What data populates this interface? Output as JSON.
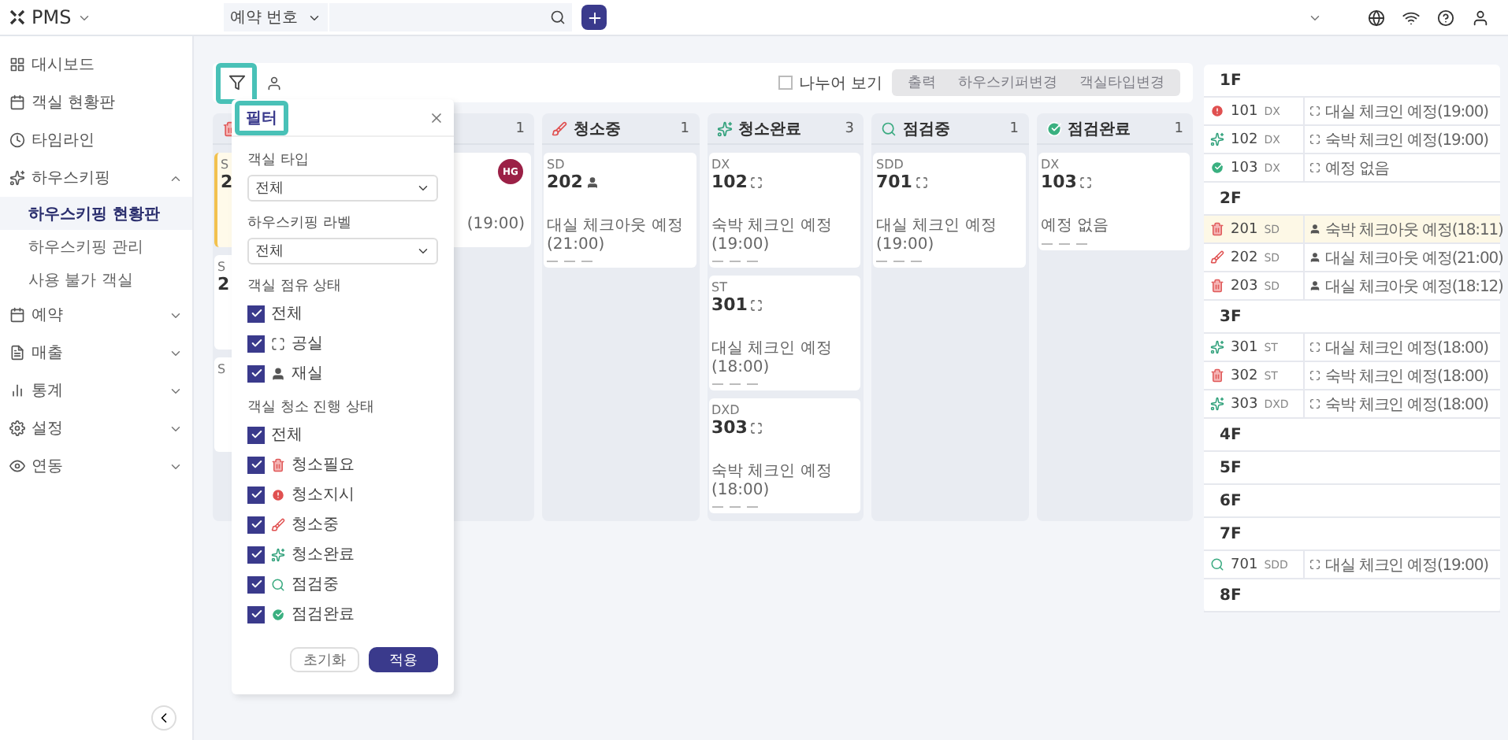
{
  "app": {
    "name": "PMS"
  },
  "search": {
    "field": "예약 번호"
  },
  "sidebar": {
    "items": [
      {
        "kind": "dashboard",
        "label": "대시보드"
      },
      {
        "kind": "rooms",
        "label": "객실 현황판"
      },
      {
        "kind": "timeline",
        "label": "타임라인"
      },
      {
        "kind": "housekeeping",
        "label": "하우스키핑",
        "expanded": true,
        "children": [
          {
            "label": "하우스키핑 현황판",
            "selected": true
          },
          {
            "label": "하우스키핑 관리",
            "selected": false
          },
          {
            "label": "사용 불가 객실",
            "selected": false
          }
        ]
      },
      {
        "kind": "reservation",
        "label": "예약",
        "expanded": false
      },
      {
        "kind": "sales",
        "label": "매출",
        "expanded": false
      },
      {
        "kind": "stats",
        "label": "통계",
        "expanded": false
      },
      {
        "kind": "settings",
        "label": "설정",
        "expanded": false
      },
      {
        "kind": "link",
        "label": "연동",
        "expanded": false
      }
    ]
  },
  "toolbar": {
    "split_view": {
      "label": "나누어 보기",
      "checked": false
    },
    "actions": [
      {
        "label": "출력",
        "disabled": true
      },
      {
        "label": "하우스키퍼변경",
        "disabled": true
      },
      {
        "label": "객실타입변경",
        "disabled": true
      }
    ]
  },
  "board": {
    "columns": [
      {
        "kind": "needed",
        "cards": [
          {
            "type": "S",
            "room": "2",
            "highlighted": true
          },
          {
            "type": "S",
            "room": "2",
            "highlighted": false
          },
          {
            "type": "S",
            "highlighted": false
          }
        ]
      },
      {
        "kind": "instruct",
        "count": "1",
        "cards": [
          {
            "avatar": "HG",
            "note": "(19:00)",
            "highlighted": false
          }
        ]
      },
      {
        "kind": "cleaning",
        "label": "청소중",
        "count": "1",
        "cards": [
          {
            "type": "SD",
            "room": "202",
            "occupied": true,
            "note": "대실 체크아웃 예정(21:00)",
            "highlighted": false
          }
        ]
      },
      {
        "kind": "done",
        "label": "청소완료",
        "count": "3",
        "cards": [
          {
            "type": "DX",
            "room": "102",
            "occupied": false,
            "note": "숙박 체크인 예정(19:00)",
            "highlighted": false
          },
          {
            "type": "ST",
            "room": "301",
            "occupied": false,
            "note": "대실 체크인 예정(18:00)",
            "highlighted": false
          },
          {
            "type": "DXD",
            "room": "303",
            "occupied": false,
            "note": "숙박 체크인 예정(18:00)",
            "highlighted": false
          }
        ]
      },
      {
        "kind": "inspecting",
        "label": "점검중",
        "count": "1",
        "cards": [
          {
            "type": "SDD",
            "room": "701",
            "occupied": false,
            "note": "대실 체크인 예정(19:00)",
            "highlighted": false
          }
        ]
      },
      {
        "kind": "inspected",
        "label": "점검완료",
        "count": "1",
        "cards": [
          {
            "type": "DX",
            "room": "103",
            "occupied": false,
            "note": "예정 없음",
            "highlighted": false
          }
        ]
      }
    ]
  },
  "filter": {
    "title": "필터",
    "room_type": {
      "label": "객실 타입",
      "value": "전체"
    },
    "label_select": {
      "label": "하우스키핑 라벨",
      "value": "전체"
    },
    "occupancy": {
      "label": "객실 점유 상태",
      "options": [
        {
          "kind": "all",
          "label": "전체",
          "checked": true
        },
        {
          "kind": "vacant",
          "label": "공실",
          "checked": true
        },
        {
          "kind": "occupied",
          "label": "재실",
          "checked": true
        }
      ]
    },
    "progress": {
      "label": "객실 청소 진행 상태",
      "options": [
        {
          "kind": "all",
          "label": "전체",
          "checked": true
        },
        {
          "kind": "needed",
          "label": "청소필요",
          "checked": true
        },
        {
          "kind": "instruct",
          "label": "청소지시",
          "checked": true
        },
        {
          "kind": "cleaning",
          "label": "청소중",
          "checked": true
        },
        {
          "kind": "done",
          "label": "청소완료",
          "checked": true
        },
        {
          "kind": "inspecting",
          "label": "점검중",
          "checked": true
        },
        {
          "kind": "inspected",
          "label": "점검완료",
          "checked": true
        }
      ]
    },
    "buttons": [
      {
        "kind": "reset",
        "label": "초기화"
      },
      {
        "kind": "apply",
        "label": "적용"
      }
    ]
  },
  "floors": [
    {
      "name": "1F",
      "rooms": [
        {
          "kind": "instruct",
          "room": "101",
          "type": "DX",
          "occupied": false,
          "note": "대실 체크인 예정(19:00)",
          "highlighted": false
        },
        {
          "kind": "done",
          "room": "102",
          "type": "DX",
          "occupied": false,
          "note": "숙박 체크인 예정(19:00)",
          "highlighted": false
        },
        {
          "kind": "inspected",
          "room": "103",
          "type": "DX",
          "occupied": false,
          "note": "예정 없음",
          "highlighted": false
        }
      ]
    },
    {
      "name": "2F",
      "rooms": [
        {
          "kind": "needed",
          "room": "201",
          "type": "SD",
          "occupied": true,
          "note": "숙박 체크아웃 예정(18:11)",
          "highlighted": true
        },
        {
          "kind": "cleaning",
          "room": "202",
          "type": "SD",
          "occupied": true,
          "note": "대실 체크아웃 예정(21:00)",
          "highlighted": false
        },
        {
          "kind": "needed",
          "room": "203",
          "type": "SD",
          "occupied": true,
          "note": "대실 체크아웃 예정(18:12)",
          "highlighted": false
        }
      ]
    },
    {
      "name": "3F",
      "rooms": [
        {
          "kind": "done",
          "room": "301",
          "type": "ST",
          "occupied": false,
          "note": "대실 체크인 예정(18:00)",
          "highlighted": false
        },
        {
          "kind": "needed",
          "room": "302",
          "type": "ST",
          "occupied": false,
          "note": "숙박 체크인 예정(18:00)",
          "highlighted": false
        },
        {
          "kind": "done",
          "room": "303",
          "type": "DXD",
          "occupied": false,
          "note": "숙박 체크인 예정(18:00)",
          "highlighted": false
        }
      ]
    },
    {
      "name": "4F"
    },
    {
      "name": "5F"
    },
    {
      "name": "6F"
    },
    {
      "name": "7F",
      "rooms": [
        {
          "kind": "inspecting",
          "room": "701",
          "type": "SDD",
          "occupied": false,
          "note": "대실 체크인 예정(19:00)",
          "highlighted": false
        }
      ]
    },
    {
      "name": "8F"
    }
  ]
}
